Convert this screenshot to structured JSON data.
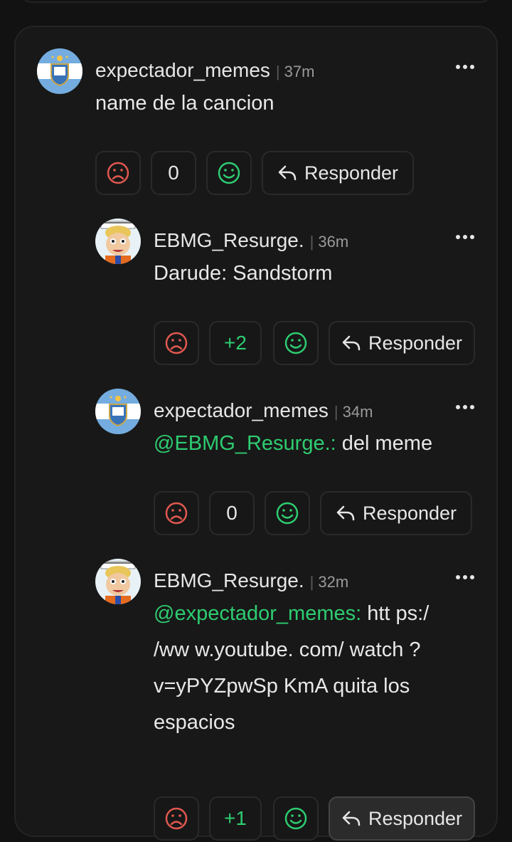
{
  "comments": [
    {
      "username": "expectador_memes",
      "separator": "|",
      "time": "37m",
      "text": "name de la cancion",
      "mention": "",
      "score": "0",
      "reply_label": "Responder"
    },
    {
      "username": "EBMG_Resurge.",
      "separator": "|",
      "time": "36m",
      "text": "Darude: Sandstorm",
      "mention": "",
      "score": "+2",
      "reply_label": "Responder"
    },
    {
      "username": "expectador_memes",
      "separator": "|",
      "time": "34m",
      "text": " del meme",
      "mention": "@EBMG_Resurge.:",
      "score": "0",
      "reply_label": "Responder"
    },
    {
      "username": "EBMG_Resurge.",
      "separator": "|",
      "time": "32m",
      "mention": "@expectador_memes:",
      "text_lines": [
        " htt ps:/",
        "/ww w.youtube. com/ watch ?",
        "v=yPYZpwSp KmA quita los",
        "espacios"
      ],
      "score": "+1",
      "reply_label": "Responder"
    }
  ],
  "icons": {
    "more": "more-dots-icon",
    "downvote": "sad-face-icon",
    "upvote": "smile-face-icon",
    "reply": "reply-arrow-icon"
  },
  "colors": {
    "accent_green": "#2ecc71",
    "downvote_red": "#e0584f"
  }
}
